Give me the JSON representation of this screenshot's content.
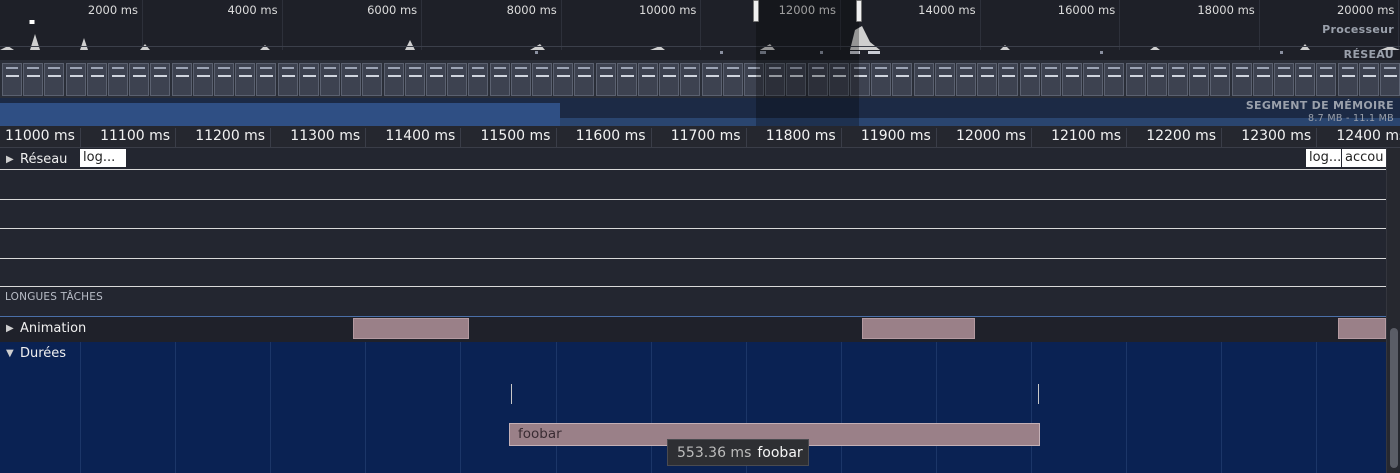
{
  "overview": {
    "ticks": [
      "2000 ms",
      "4000 ms",
      "6000 ms",
      "8000 ms",
      "10000 ms",
      "12000 ms",
      "14000 ms",
      "16000 ms",
      "18000 ms",
      "20000 ms"
    ],
    "cpu_label": "Processeur",
    "network_label": "RÉSEAU",
    "heap_label": "SEGMENT DE MÉMOIRE",
    "heap_range": "8.7 MB - 11.1 MB"
  },
  "ruler": {
    "ticks": [
      "11000 ms",
      "11100 ms",
      "11200 ms",
      "11300 ms",
      "11400 ms",
      "11500 ms",
      "11600 ms",
      "11700 ms",
      "11800 ms",
      "11900 ms",
      "12000 ms",
      "12100 ms",
      "12200 ms",
      "12300 ms",
      "12400 ms"
    ]
  },
  "tracks": {
    "network": {
      "label": "Réseau",
      "requests": [
        "log...",
        "log...",
        "accou"
      ]
    },
    "long_tasks_label": "LONGUES TÂCHES",
    "animation": {
      "label": "Animation"
    },
    "durations": {
      "label": "Durées",
      "bar_label": "foobar"
    }
  },
  "tooltip": {
    "duration": "553.36 ms",
    "name": "foobar"
  },
  "colors": {
    "background": "#232630",
    "durations_bg": "#0a2253",
    "event_bar": "#9a8088",
    "heap": "#2f4f84"
  }
}
